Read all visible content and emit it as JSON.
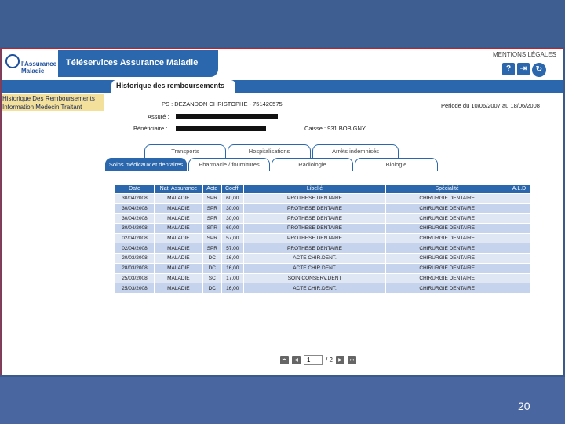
{
  "app": {
    "logo_line1": "l'Assurance",
    "logo_line2": "Maladie",
    "title": "Téléservices Assurance Maladie",
    "mentions": "MENTIONS LÉGALES",
    "icons": [
      "help-icon",
      "exit-icon",
      "refresh-icon"
    ],
    "icon_glyphs": [
      "?",
      "⇥",
      "↻"
    ]
  },
  "section": {
    "title": "Historique des remboursements"
  },
  "sidebar": {
    "items": [
      {
        "label": "Historique Des Remboursements"
      },
      {
        "label": "Information Medecin Traitant"
      }
    ]
  },
  "info": {
    "ps": "PS : DEZANDON CHRISTOPHE - 751420575",
    "periode": "Période du 10/06/2007 au 18/06/2008",
    "assure": "Assuré :",
    "beneficiaire": "Bénéficiaire :",
    "caisse": "Caisse : 931 BOBIGNY"
  },
  "tabs_row1": [
    "Transports",
    "Hospitalisations",
    "Arrêts indemnisés"
  ],
  "tabs_row2": [
    "Soins médicaux et dentaires",
    "Pharmacie / fournitures",
    "Radiologie",
    "Biologie"
  ],
  "table": {
    "headers": [
      "Date",
      "Nat. Assurance",
      "Acte",
      "Coeff.",
      "Libellé",
      "Spécialité",
      "A.L.D"
    ],
    "rows": [
      [
        "30/04/2008",
        "MALADIE",
        "SPR",
        "60,00",
        "PROTHESE DENTAIRE",
        "CHIRURGIE DENTAIRE",
        ""
      ],
      [
        "30/04/2008",
        "MALADIE",
        "SPR",
        "30,00",
        "PROTHESE DENTAIRE",
        "CHIRURGIE DENTAIRE",
        ""
      ],
      [
        "30/04/2008",
        "MALADIE",
        "SPR",
        "30,00",
        "PROTHESE DENTAIRE",
        "CHIRURGIE DENTAIRE",
        ""
      ],
      [
        "30/04/2008",
        "MALADIE",
        "SPR",
        "60,00",
        "PROTHESE DENTAIRE",
        "CHIRURGIE DENTAIRE",
        ""
      ],
      [
        "02/04/2008",
        "MALADIE",
        "SPR",
        "57,00",
        "PROTHESE DENTAIRE",
        "CHIRURGIE DENTAIRE",
        ""
      ],
      [
        "02/04/2008",
        "MALADIE",
        "SPR",
        "57,00",
        "PROTHESE DENTAIRE",
        "CHIRURGIE DENTAIRE",
        ""
      ],
      [
        "20/03/2008",
        "MALADIE",
        "DC",
        "16,00",
        "ACTE CHIR.DENT.",
        "CHIRURGIE DENTAIRE",
        ""
      ],
      [
        "28/03/2008",
        "MALADIE",
        "DC",
        "16,00",
        "ACTE CHIR.DENT.",
        "CHIRURGIE DENTAIRE",
        ""
      ],
      [
        "25/03/2008",
        "MALADIE",
        "SC",
        "17,00",
        "SOIN CONSERV.DENT",
        "CHIRURGIE DENTAIRE",
        ""
      ],
      [
        "25/03/2008",
        "MALADIE",
        "DC",
        "16,00",
        "ACTE CHIR.DENT.",
        "CHIRURGIE DENTAIRE",
        ""
      ]
    ]
  },
  "pager": {
    "current": "1",
    "total": "/ 2",
    "buttons": [
      "⏮",
      "◀",
      "▶",
      "⏭"
    ]
  },
  "slide": {
    "number": "20"
  },
  "colors": {
    "brand": "#2a67ad",
    "sidebar": "#f3e09a",
    "frame_border": "#c8202a",
    "slide_bg": "#3b5a8c"
  }
}
